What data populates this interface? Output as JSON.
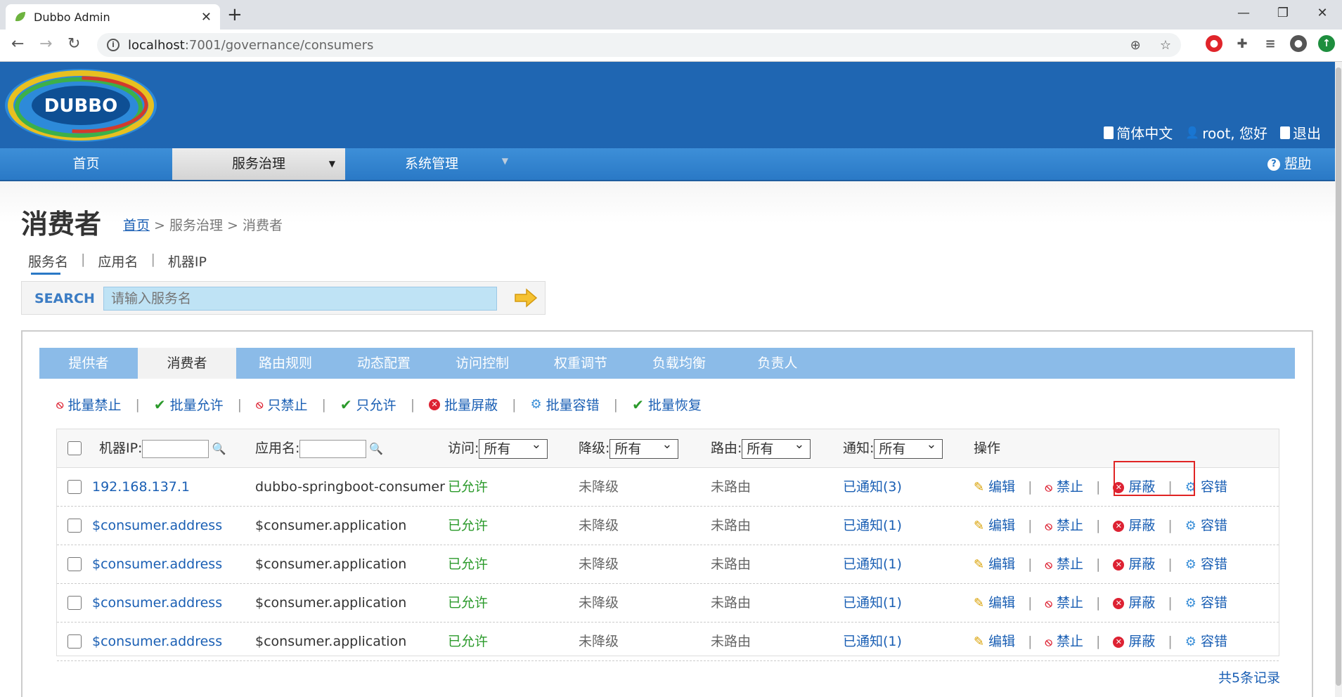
{
  "browser": {
    "tab_title": "Dubbo Admin",
    "tab_close": "✕",
    "new_tab": "+",
    "url_host": "localhost",
    "url_rest": ":7001/governance/consumers"
  },
  "header": {
    "logo_text": "DUBBO",
    "lang": "简体中文",
    "user": "root, 您好",
    "logout": "退出"
  },
  "nav": {
    "home": "首页",
    "governance": "服务治理",
    "system": "系统管理",
    "help": "帮助"
  },
  "page": {
    "title": "消费者",
    "breadcrumb_home": "首页",
    "breadcrumb_rest": " > 服务治理 > 消费者"
  },
  "search": {
    "tabs": [
      "服务名",
      "应用名",
      "机器IP"
    ],
    "label": "SEARCH",
    "placeholder": "请输入服务名"
  },
  "sub_tabs": [
    "提供者",
    "消费者",
    "路由规则",
    "动态配置",
    "访问控制",
    "权重调节",
    "负载均衡",
    "负责人"
  ],
  "batch_actions": [
    "批量禁止",
    "批量允许",
    "只禁止",
    "只允许",
    "批量屏蔽",
    "批量容错",
    "批量恢复"
  ],
  "table": {
    "headers": {
      "ip": "机器IP:",
      "app": "应用名:",
      "access": "访问:",
      "degrade": "降级:",
      "route": "路由:",
      "notify": "通知:",
      "ops": "操作"
    },
    "filter_value": "所有",
    "op_labels": [
      "编辑",
      "禁止",
      "屏蔽",
      "容错"
    ],
    "rows": [
      {
        "ip": "192.168.137.1",
        "app": "dubbo-springboot-consumer",
        "access": "已允许",
        "degrade": "未降级",
        "route": "未路由",
        "notify": "已通知(3)"
      },
      {
        "ip": "$consumer.address",
        "app": "$consumer.application",
        "access": "已允许",
        "degrade": "未降级",
        "route": "未路由",
        "notify": "已通知(1)"
      },
      {
        "ip": "$consumer.address",
        "app": "$consumer.application",
        "access": "已允许",
        "degrade": "未降级",
        "route": "未路由",
        "notify": "已通知(1)"
      },
      {
        "ip": "$consumer.address",
        "app": "$consumer.application",
        "access": "已允许",
        "degrade": "未降级",
        "route": "未路由",
        "notify": "已通知(1)"
      },
      {
        "ip": "$consumer.address",
        "app": "$consumer.application",
        "access": "已允许",
        "degrade": "未降级",
        "route": "未路由",
        "notify": "已通知(1)"
      }
    ],
    "total": "共5条记录"
  },
  "colors": {
    "header_blue": "#1f66b2",
    "nav_blue": "#2a79c6",
    "link": "#1a5fb4",
    "ok_green": "#2b9a2b",
    "highlight_red": "#e02424"
  }
}
